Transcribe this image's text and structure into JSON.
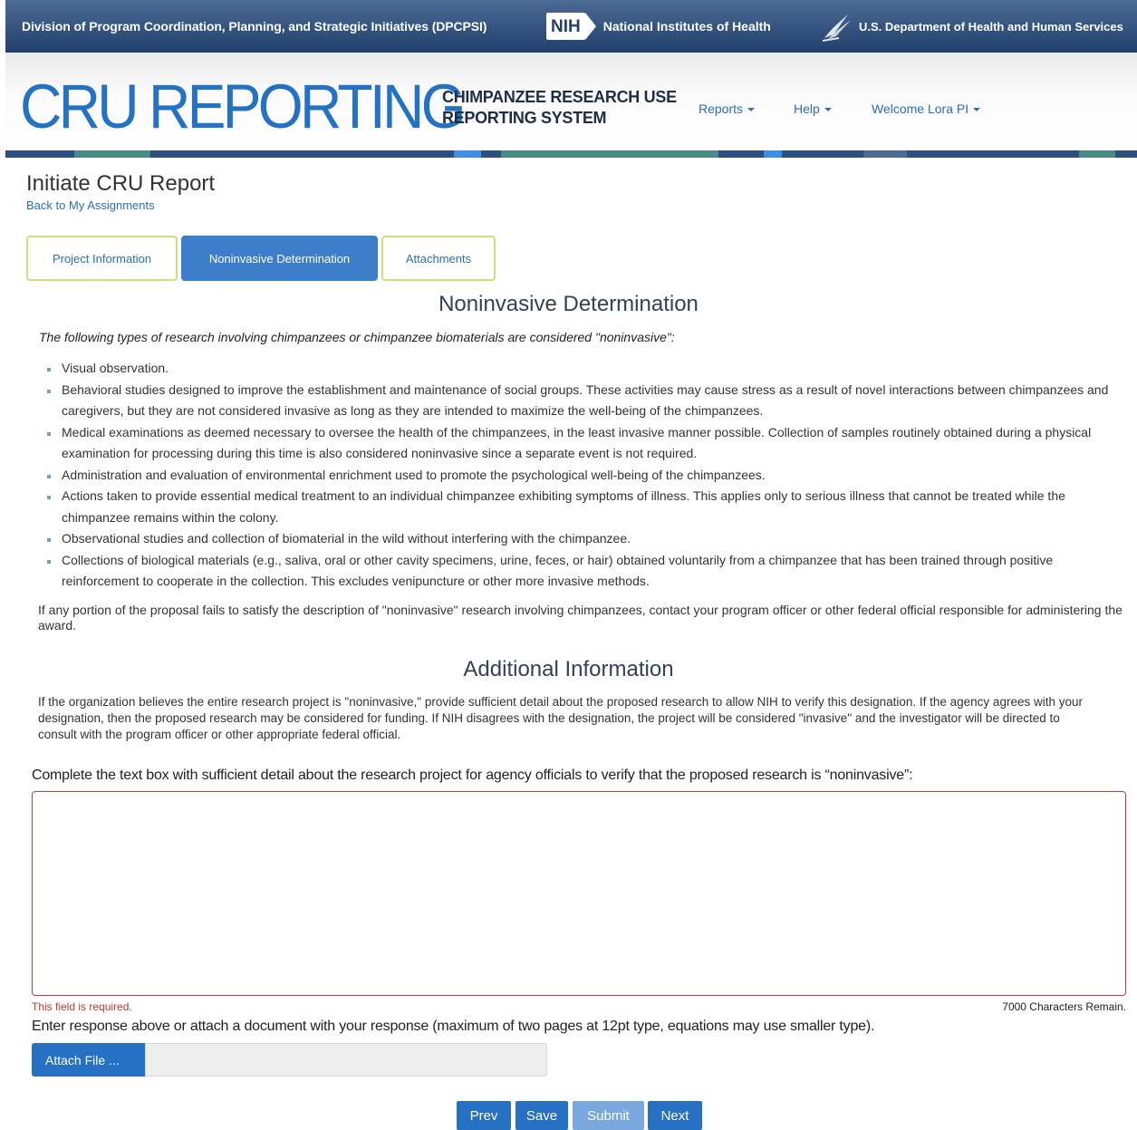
{
  "gov_bar": {
    "division": "Division of Program Coordination, Planning, and Strategic Initiatives (DPCPSI)",
    "nih_badge": "NIH",
    "nih_name": "National Institutes of Health",
    "hhs_name": "U.S. Department of Health and Human Services"
  },
  "header": {
    "logo": "CRU REPORTING",
    "subtitle_line1": "CHIMPANZEE RESEARCH USE",
    "subtitle_line2": "REPORTING SYSTEM",
    "nav": {
      "reports": "Reports",
      "help": "Help",
      "welcome": "Welcome Lora PI"
    }
  },
  "page": {
    "title": "Initiate CRU Report",
    "back_link": "Back to My Assignments"
  },
  "tabs": [
    {
      "label": "Project Information",
      "active": false
    },
    {
      "label": "Noninvasive Determination",
      "active": true
    },
    {
      "label": "Attachments",
      "active": false
    }
  ],
  "noninvasive": {
    "heading": "Noninvasive Determination",
    "intro": "The following types of research involving chimpanzees or chimpanzee biomaterials are considered \"noninvasive\":",
    "bullets": [
      "Visual observation.",
      "Behavioral studies designed to improve the establishment and maintenance of social groups. These activities may cause stress as a result of novel interactions between chimpanzees and caregivers, but they are not considered invasive as long as they are intended to maximize the well-being of the chimpanzees.",
      "Medical examinations as deemed necessary to oversee the health of the chimpanzees, in the least invasive manner possible. Collection of samples routinely obtained during a physical examination for processing during this time is also considered noninvasive since a separate event is not required.",
      "Administration and evaluation of environmental enrichment used to promote the psychological well-being of the chimpanzees.",
      "Actions taken to provide essential medical treatment to an individual chimpanzee exhibiting symptoms of illness. This applies only to serious illness that cannot be treated while the chimpanzee remains within the colony.",
      "Observational studies and collection of biomaterial in the wild without interfering with the chimpanzee.",
      "Collections of biological materials (e.g., saliva, oral or other cavity specimens, urine, feces, or hair) obtained voluntarily from a chimpanzee that has been trained through positive reinforcement to cooperate in the collection. This excludes venipuncture or other more invasive methods."
    ],
    "closing": "If any portion of the proposal fails to satisfy the description of \"noninvasive\" research involving chimpanzees, contact your program officer or other federal official responsible for administering the award."
  },
  "additional": {
    "heading": "Additional Information",
    "text": "If the organization believes the entire research project is \"noninvasive,\" provide sufficient detail about the proposed research to allow NIH to verify this designation. If the agency agrees with your designation, then the proposed research may be considered for funding. If NIH disagrees with the designation, the project will be considered \"invasive\" and the investigator will be directed to consult with the program officer or other appropriate federal official.",
    "prompt": "Complete the text box with sufficient detail about the research project for agency officials to verify that the proposed research is “noninvasive”:",
    "textbox_value": "",
    "required_msg": "This field is required.",
    "chars_remaining": "7000 Characters Remain.",
    "attach_note": "Enter response above or attach a document with your response (maximum of two pages at 12pt type, equations may use smaller type).",
    "attach_button": "Attach File ...",
    "attach_field_value": ""
  },
  "actions": {
    "prev": "Prev",
    "save": "Save",
    "submit": "Submit",
    "next": "Next"
  },
  "colors": {
    "brand_blue": "#2372c4",
    "button_blue": "#2671c4",
    "tab_border": "#c7e37a",
    "error_red": "#c0392b"
  }
}
